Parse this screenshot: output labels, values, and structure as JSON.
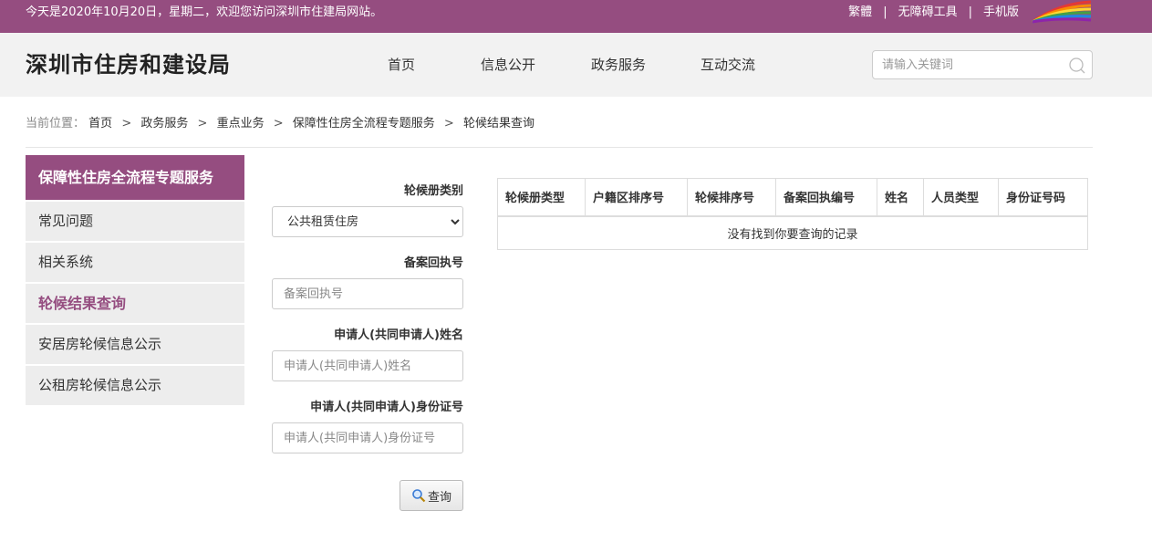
{
  "topbar": {
    "welcome": "今天是2020年10月20日，星期二，欢迎您访问深圳市住建局网站。",
    "traditional": "繁體",
    "accessibility": "无障碍工具",
    "mobile": "手机版",
    "separator": "|",
    "bg_color": "#954d80"
  },
  "header": {
    "site_title": "深圳市住房和建设局",
    "nav": [
      "首页",
      "信息公开",
      "政务服务",
      "互动交流"
    ],
    "search_placeholder": "请输入关键词"
  },
  "breadcrumb": {
    "prefix": "当前位置：",
    "items": [
      "首页",
      "政务服务",
      "重点业务",
      "保障性住房全流程专题服务",
      "轮候结果查询"
    ],
    "separator": ">"
  },
  "sidebar": {
    "heading": "保障性住房全流程专题服务",
    "items": [
      "常见问题",
      "相关系统",
      "轮候结果查询",
      "安居房轮候信息公示",
      "公租房轮候信息公示"
    ],
    "active_index": 2,
    "accent": "#954d80"
  },
  "form": {
    "type_label": "轮候册类别",
    "type_selected": "公共租赁住房",
    "receipt_label": "备案回执号",
    "receipt_placeholder": "备案回执号",
    "name_label": "申请人(共同申请人)姓名",
    "name_placeholder": "申请人(共同申请人)姓名",
    "id_label": "申请人(共同申请人)身份证号",
    "id_placeholder": "申请人(共同申请人)身份证号",
    "query_button": "查询"
  },
  "results": {
    "columns": [
      "轮候册类型",
      "户籍区排序号",
      "轮候排序号",
      "备案回执编号",
      "姓名",
      "人员类型",
      "身份证号码"
    ],
    "empty_message": "没有找到你要查询的记录"
  }
}
